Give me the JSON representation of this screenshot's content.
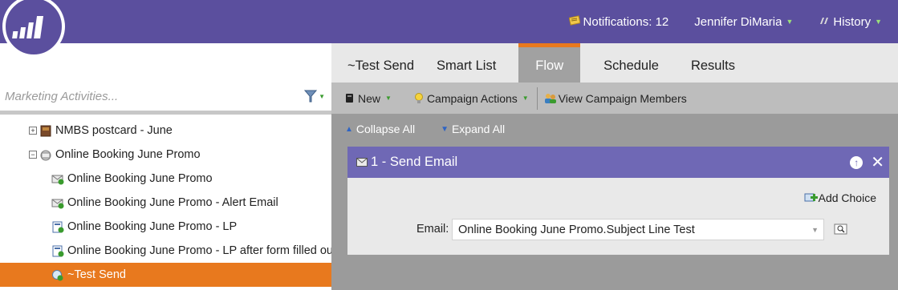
{
  "header": {
    "notifications_label": "Notifications: 12",
    "user_name": "Jennifer DiMaria",
    "history_label": "History"
  },
  "left_panel": {
    "search_placeholder": "Marketing Activities...",
    "tree": [
      {
        "label": "NMBS postcard - June",
        "toggle": "+",
        "icon": "program-icon"
      },
      {
        "label": "Online Booking June Promo",
        "toggle": "−",
        "icon": "email-program-icon"
      },
      {
        "label": "Online Booking June Promo",
        "icon": "email-asset-icon"
      },
      {
        "label": "Online Booking June Promo - Alert Email",
        "icon": "email-asset-icon"
      },
      {
        "label": "Online Booking June Promo - LP",
        "icon": "landing-page-icon"
      },
      {
        "label": "Online Booking June Promo - LP after form filled out",
        "icon": "landing-page-icon"
      },
      {
        "label": "~Test Send",
        "icon": "smart-campaign-icon",
        "selected": true
      }
    ]
  },
  "tabs": [
    "~Test Send",
    "Smart List",
    "Flow",
    "Schedule",
    "Results"
  ],
  "active_tab": "Flow",
  "toolbar": {
    "new_label": "New",
    "campaign_actions_label": "Campaign Actions",
    "view_members_label": "View Campaign Members"
  },
  "flow": {
    "collapse_all": "Collapse All",
    "expand_all": "Expand All",
    "step_title": "1 - Send Email",
    "add_choice": "Add Choice",
    "email_label": "Email:",
    "email_value": "Online Booking June Promo.Subject Line Test"
  },
  "colors": {
    "header_purple": "#5b4f9e",
    "step_header": "#6f68b5",
    "accent_orange": "#e8791e"
  }
}
